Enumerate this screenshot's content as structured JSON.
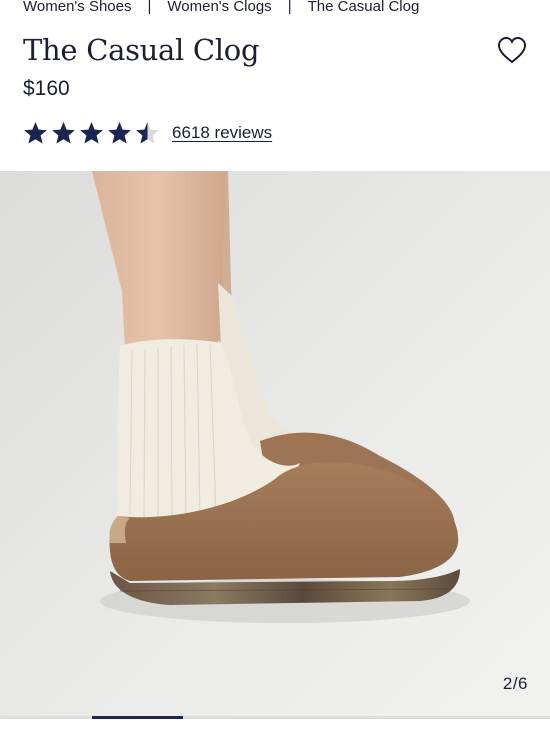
{
  "breadcrumb": {
    "items": [
      "Women's Shoes",
      "Women's Clogs",
      "The Casual Clog"
    ],
    "separator": "|"
  },
  "product": {
    "title": "The Casual Clog",
    "price": "$160",
    "rating": 4.5,
    "rating_max": 5,
    "reviews_label": "6618 reviews"
  },
  "gallery": {
    "counter": "2/6",
    "current": 2,
    "total": 6
  },
  "colors": {
    "text": "#1b2030",
    "star": "#1b2552",
    "progress": "#1b2552",
    "gallery_bg": "#e8e8e6"
  },
  "icons": {
    "wishlist": "heart-icon",
    "rating": "star-icon"
  }
}
